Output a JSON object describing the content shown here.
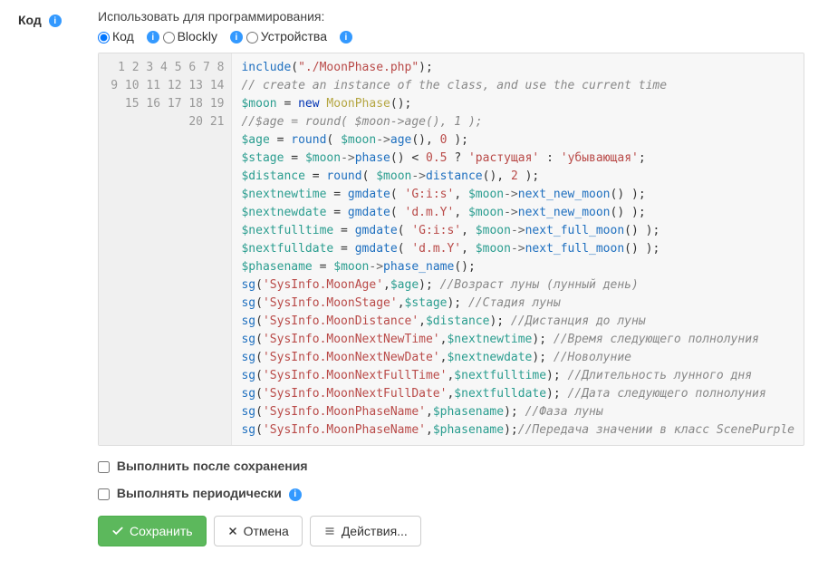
{
  "leftLabel": "Код",
  "sectionLabel": "Использовать для программирования:",
  "radios": {
    "code": "Код",
    "blockly": "Blockly",
    "devices": "Устройства"
  },
  "code": {
    "lines": [
      [
        [
          "fn",
          "include"
        ],
        [
          "p",
          "("
        ],
        [
          "str",
          "\"./MoonPhase.php\""
        ],
        [
          "p",
          ");"
        ]
      ],
      [
        [
          "cmt",
          "// create an instance of the class, and use the current time"
        ]
      ],
      [
        [
          "var",
          "$moon"
        ],
        [
          "p",
          " = "
        ],
        [
          "kw",
          "new"
        ],
        [
          "p",
          " "
        ],
        [
          "cls",
          "MoonPhase"
        ],
        [
          "p",
          "();"
        ]
      ],
      [
        [
          "cmt",
          "//$age = round( $moon->age(), 1 );"
        ]
      ],
      [
        [
          "var",
          "$age"
        ],
        [
          "p",
          " = "
        ],
        [
          "fn",
          "round"
        ],
        [
          "p",
          "( "
        ],
        [
          "var",
          "$moon"
        ],
        [
          "op",
          "->"
        ],
        [
          "fn",
          "age"
        ],
        [
          "p",
          "(), "
        ],
        [
          "num",
          "0"
        ],
        [
          "p",
          " );"
        ]
      ],
      [
        [
          "var",
          "$stage"
        ],
        [
          "p",
          " = "
        ],
        [
          "var",
          "$moon"
        ],
        [
          "op",
          "->"
        ],
        [
          "fn",
          "phase"
        ],
        [
          "p",
          "() < "
        ],
        [
          "num",
          "0.5"
        ],
        [
          "p",
          " ? "
        ],
        [
          "str",
          "'растущая'"
        ],
        [
          "p",
          " : "
        ],
        [
          "str",
          "'убывающая'"
        ],
        [
          "p",
          ";"
        ]
      ],
      [
        [
          "var",
          "$distance"
        ],
        [
          "p",
          " = "
        ],
        [
          "fn",
          "round"
        ],
        [
          "p",
          "( "
        ],
        [
          "var",
          "$moon"
        ],
        [
          "op",
          "->"
        ],
        [
          "fn",
          "distance"
        ],
        [
          "p",
          "(), "
        ],
        [
          "num",
          "2"
        ],
        [
          "p",
          " );"
        ]
      ],
      [
        [
          "var",
          "$nextnewtime"
        ],
        [
          "p",
          " = "
        ],
        [
          "fn",
          "gmdate"
        ],
        [
          "p",
          "( "
        ],
        [
          "str",
          "'G:i:s'"
        ],
        [
          "p",
          ", "
        ],
        [
          "var",
          "$moon"
        ],
        [
          "op",
          "->"
        ],
        [
          "fn",
          "next_new_moon"
        ],
        [
          "p",
          "() );"
        ]
      ],
      [
        [
          "var",
          "$nextnewdate"
        ],
        [
          "p",
          " = "
        ],
        [
          "fn",
          "gmdate"
        ],
        [
          "p",
          "( "
        ],
        [
          "str",
          "'d.m.Y'"
        ],
        [
          "p",
          ", "
        ],
        [
          "var",
          "$moon"
        ],
        [
          "op",
          "->"
        ],
        [
          "fn",
          "next_new_moon"
        ],
        [
          "p",
          "() );"
        ]
      ],
      [
        [
          "var",
          "$nextfulltime"
        ],
        [
          "p",
          " = "
        ],
        [
          "fn",
          "gmdate"
        ],
        [
          "p",
          "( "
        ],
        [
          "str",
          "'G:i:s'"
        ],
        [
          "p",
          ", "
        ],
        [
          "var",
          "$moon"
        ],
        [
          "op",
          "->"
        ],
        [
          "fn",
          "next_full_moon"
        ],
        [
          "p",
          "() );"
        ]
      ],
      [
        [
          "var",
          "$nextfulldate"
        ],
        [
          "p",
          " = "
        ],
        [
          "fn",
          "gmdate"
        ],
        [
          "p",
          "( "
        ],
        [
          "str",
          "'d.m.Y'"
        ],
        [
          "p",
          ", "
        ],
        [
          "var",
          "$moon"
        ],
        [
          "op",
          "->"
        ],
        [
          "fn",
          "next_full_moon"
        ],
        [
          "p",
          "() );"
        ]
      ],
      [
        [
          "var",
          "$phasename"
        ],
        [
          "p",
          " = "
        ],
        [
          "var",
          "$moon"
        ],
        [
          "op",
          "->"
        ],
        [
          "fn",
          "phase_name"
        ],
        [
          "p",
          "();"
        ]
      ],
      [
        [
          "fn",
          "sg"
        ],
        [
          "p",
          "("
        ],
        [
          "str",
          "'SysInfo.MoonAge'"
        ],
        [
          "p",
          ","
        ],
        [
          "var",
          "$age"
        ],
        [
          "p",
          "); "
        ],
        [
          "cmt",
          "//Возраст луны (лунный день)"
        ]
      ],
      [
        [
          "fn",
          "sg"
        ],
        [
          "p",
          "("
        ],
        [
          "str",
          "'SysInfo.MoonStage'"
        ],
        [
          "p",
          ","
        ],
        [
          "var",
          "$stage"
        ],
        [
          "p",
          "); "
        ],
        [
          "cmt",
          "//Стадия луны"
        ]
      ],
      [
        [
          "fn",
          "sg"
        ],
        [
          "p",
          "("
        ],
        [
          "str",
          "'SysInfo.MoonDistance'"
        ],
        [
          "p",
          ","
        ],
        [
          "var",
          "$distance"
        ],
        [
          "p",
          "); "
        ],
        [
          "cmt",
          "//Дистанция до луны"
        ]
      ],
      [
        [
          "fn",
          "sg"
        ],
        [
          "p",
          "("
        ],
        [
          "str",
          "'SysInfo.MoonNextNewTime'"
        ],
        [
          "p",
          ","
        ],
        [
          "var",
          "$nextnewtime"
        ],
        [
          "p",
          "); "
        ],
        [
          "cmt",
          "//Время следующего полнолуния"
        ]
      ],
      [
        [
          "fn",
          "sg"
        ],
        [
          "p",
          "("
        ],
        [
          "str",
          "'SysInfo.MoonNextNewDate'"
        ],
        [
          "p",
          ","
        ],
        [
          "var",
          "$nextnewdate"
        ],
        [
          "p",
          "); "
        ],
        [
          "cmt",
          "//Новолуние"
        ]
      ],
      [
        [
          "fn",
          "sg"
        ],
        [
          "p",
          "("
        ],
        [
          "str",
          "'SysInfo.MoonNextFullTime'"
        ],
        [
          "p",
          ","
        ],
        [
          "var",
          "$nextfulltime"
        ],
        [
          "p",
          "); "
        ],
        [
          "cmt",
          "//Длительность лунного дня"
        ]
      ],
      [
        [
          "fn",
          "sg"
        ],
        [
          "p",
          "("
        ],
        [
          "str",
          "'SysInfo.MoonNextFullDate'"
        ],
        [
          "p",
          ","
        ],
        [
          "var",
          "$nextfulldate"
        ],
        [
          "p",
          "); "
        ],
        [
          "cmt",
          "//Дата следующего полнолуния"
        ]
      ],
      [
        [
          "fn",
          "sg"
        ],
        [
          "p",
          "("
        ],
        [
          "str",
          "'SysInfo.MoonPhaseName'"
        ],
        [
          "p",
          ","
        ],
        [
          "var",
          "$phasename"
        ],
        [
          "p",
          "); "
        ],
        [
          "cmt",
          "//Фаза луны"
        ]
      ],
      [
        [
          "fn",
          "sg"
        ],
        [
          "p",
          "("
        ],
        [
          "str",
          "'SysInfo.MoonPhaseName'"
        ],
        [
          "p",
          ","
        ],
        [
          "var",
          "$phasename"
        ],
        [
          "p",
          ");"
        ],
        [
          "cmt",
          "//Передача значении в класс ScenePurple"
        ]
      ]
    ]
  },
  "checks": {
    "runAfterSave": "Выполнить после сохранения",
    "runPeriodically": "Выполнять периодически"
  },
  "buttons": {
    "save": "Сохранить",
    "cancel": "Отмена",
    "actions": "Действия..."
  }
}
